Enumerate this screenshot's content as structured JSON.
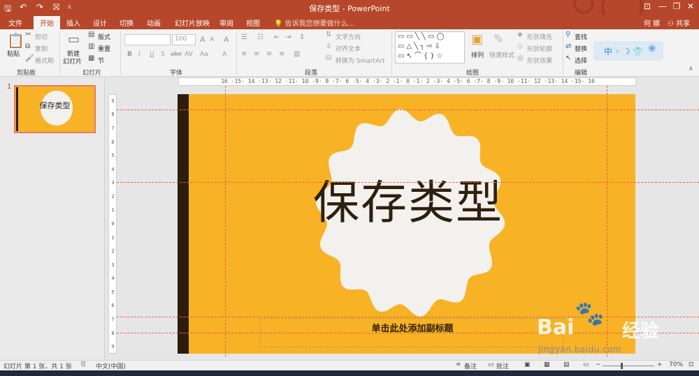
{
  "window": {
    "title": "保存类型 - PowerPoint",
    "user": "何 娜",
    "share": "共享",
    "quick_access": {
      "save_icon": "save-icon",
      "undo_icon": "undo-icon",
      "redo_icon": "redo-icon",
      "present_icon": "start-presentation-icon",
      "customize_icon": "customize-qat-icon"
    },
    "controls": {
      "ribbon_options_icon": "ribbon-display-options-icon",
      "minimize": "—",
      "restore": "❐",
      "close": "✕"
    }
  },
  "tabs": [
    {
      "label": "文件",
      "active": false
    },
    {
      "label": "开始",
      "active": true
    },
    {
      "label": "插入",
      "active": false
    },
    {
      "label": "设计",
      "active": false
    },
    {
      "label": "切换",
      "active": false
    },
    {
      "label": "动画",
      "active": false
    },
    {
      "label": "幻灯片放映",
      "active": false
    },
    {
      "label": "审阅",
      "active": false
    },
    {
      "label": "视图",
      "active": false
    }
  ],
  "tell_me": {
    "placeholder": "告诉我您想要做什么..."
  },
  "ribbon": {
    "clipboard": {
      "label": "剪贴板",
      "paste": "粘贴",
      "cut": "剪切",
      "copy": "复制",
      "format_painter": "格式刷"
    },
    "slides": {
      "label": "幻灯片",
      "new_slide": "新建",
      "new_slide_line2": "幻灯片",
      "layout": "版式",
      "reset": "重置",
      "section": "节"
    },
    "font": {
      "label": "字体",
      "font_name": "",
      "font_size": "100",
      "bold": "B",
      "italic": "I",
      "underline": "U",
      "shadow": "S",
      "strike": "abc",
      "spacing": "AV",
      "case": "Aa",
      "color": "A",
      "grow": "A",
      "shrink": "A",
      "clear": "A"
    },
    "paragraph": {
      "label": "段落",
      "text_direction": "文字方向",
      "align_text": "对齐文本",
      "smartart": "转换为 SmartArt"
    },
    "drawing": {
      "label": "绘图",
      "arrange": "排列",
      "quick_styles": "快速样式",
      "shape_fill": "形状填充",
      "shape_outline": "形状轮廓",
      "shape_effects": "形状效果",
      "shapes_gallery": "▭▭╲╲▭◯ ▭△╲┐⇨⇩ ▭↖⌒{}☆"
    },
    "editing": {
      "label": "编辑",
      "find": "查找",
      "replace": "替换",
      "select": "选择"
    }
  },
  "ime_bar": {
    "text": "中 ◦ ☽ 👕"
  },
  "thumbnail": {
    "number": "1",
    "title": "保存类型"
  },
  "ruler_h": "16 ·15· 14 ·13· 12 ·11· 10 ·9· 8 ·7· 6 ·5· 4 ·3· 2 ·1· 0 ·1· 2 ·3· 4 ·5· 6 ·7· 8 ·9· 10 ·11· 12 ·13· 14 ·15· 16",
  "ruler_v": [
    "9",
    "8",
    "7",
    "6",
    "5",
    "4",
    "3",
    "2",
    "1",
    "0",
    "1",
    "2",
    "3",
    "4",
    "5",
    "6",
    "7",
    "8",
    "9"
  ],
  "slide": {
    "title": "保存类型",
    "subtitle": "单击此处添加副标题"
  },
  "watermark": {
    "brand": "Bai",
    "brand2": "经验",
    "url": "jingyan.baidu.com"
  },
  "status": {
    "slide_info": "幻灯片 第 1 张，共 1 张",
    "language": "中文(中国)",
    "notes": "备注",
    "comments": "批注",
    "zoom": "70%"
  },
  "colors": {
    "accent": "#b7472a",
    "slide_bg": "#f7b226",
    "slide_bar": "#2c1d0d",
    "badge": "#f3f1ee"
  }
}
